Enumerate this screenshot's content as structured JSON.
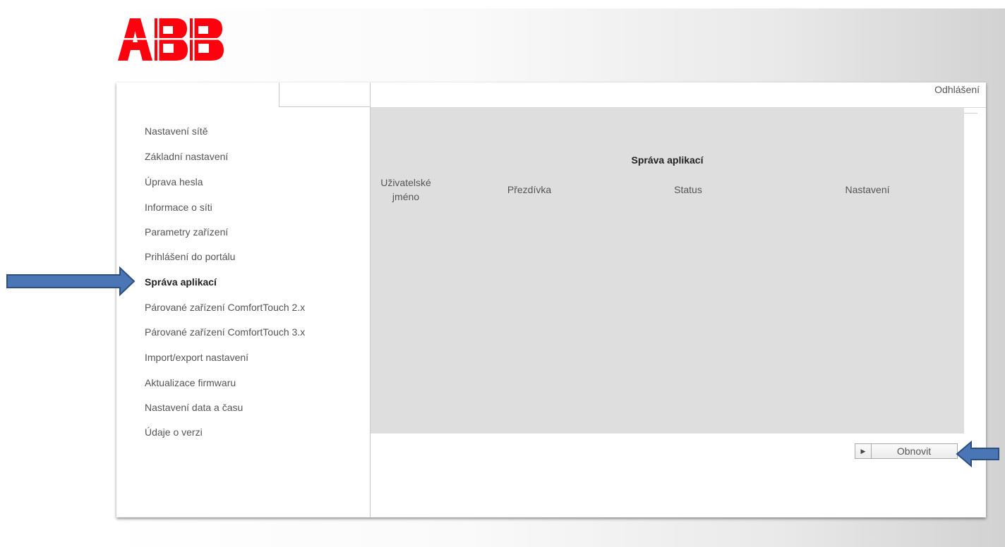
{
  "brand": {
    "logo_text": "ABB",
    "color": "#ff000f"
  },
  "header": {
    "logout_label": "Odhlášení"
  },
  "nav": {
    "items": [
      {
        "label": "Nastavení sítě"
      },
      {
        "label": "Základní nastavení"
      },
      {
        "label": "Úprava hesla"
      },
      {
        "label": "Informace o síti"
      },
      {
        "label": "Parametry zařízení"
      },
      {
        "label": "Prihlášení do portálu"
      },
      {
        "label": "Správa aplikací",
        "active": true
      },
      {
        "label": "Párované zařízení ComfortTouch 2.x"
      },
      {
        "label": "Párované zařízení ComfortTouch 3.x"
      },
      {
        "label": "Import/export nastavení"
      },
      {
        "label": "Aktualizace firmwaru"
      },
      {
        "label": "Nastavení data a času"
      },
      {
        "label": "Údaje o verzi"
      }
    ]
  },
  "main": {
    "title": "Správa aplikací",
    "columns": {
      "username_line1": "Uživatelské",
      "username_line2": "jméno",
      "nickname": "Přezdívka",
      "status": "Status",
      "settings": "Nastavení"
    },
    "refresh_label": "Obnovit",
    "refresh_icon": "play-triangle-icon"
  },
  "annotations": {
    "arrow_color": "#4a76b5",
    "arrow_outline": "#2c4f80"
  }
}
